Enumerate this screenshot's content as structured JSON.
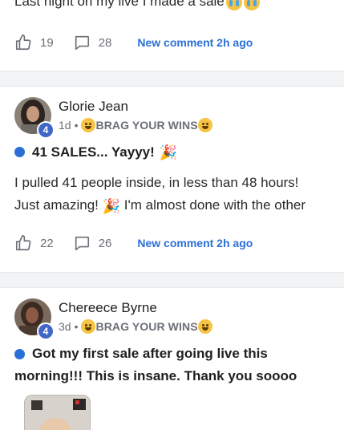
{
  "post0": {
    "text": "Last night on my live I made a sale",
    "likes": "19",
    "comments": "28",
    "new_comment": "New comment 2h ago"
  },
  "post1": {
    "author": "Glorie Jean",
    "level": "4",
    "time": "1d",
    "separator": "•",
    "category": "BRAG YOUR WINS",
    "title": "41 SALES... Yayyy!",
    "body_line1": "I pulled 41 people inside, in less than 48 hours!",
    "body_line2a": "Just amazing!",
    "body_line2b": "I'm almost done with the other",
    "likes": "22",
    "comments": "26",
    "new_comment": "New comment 2h ago"
  },
  "post2": {
    "author": "Chereece Byrne",
    "level": "4",
    "time": "3d",
    "separator": "•",
    "category": "BRAG YOUR WINS",
    "title_line1": "Got my first sale after going live this",
    "title_line2": "morning!!! This is insane. Thank you soooo"
  },
  "colors": {
    "accent": "#2b6fd6",
    "level_badge": "#3f67c8",
    "muted": "#6b6f76"
  },
  "icons": [
    "thumbs-up-icon",
    "comment-bubble-icon",
    "party-face-emoji",
    "crying-face-emoji",
    "party-popper-emoji"
  ]
}
